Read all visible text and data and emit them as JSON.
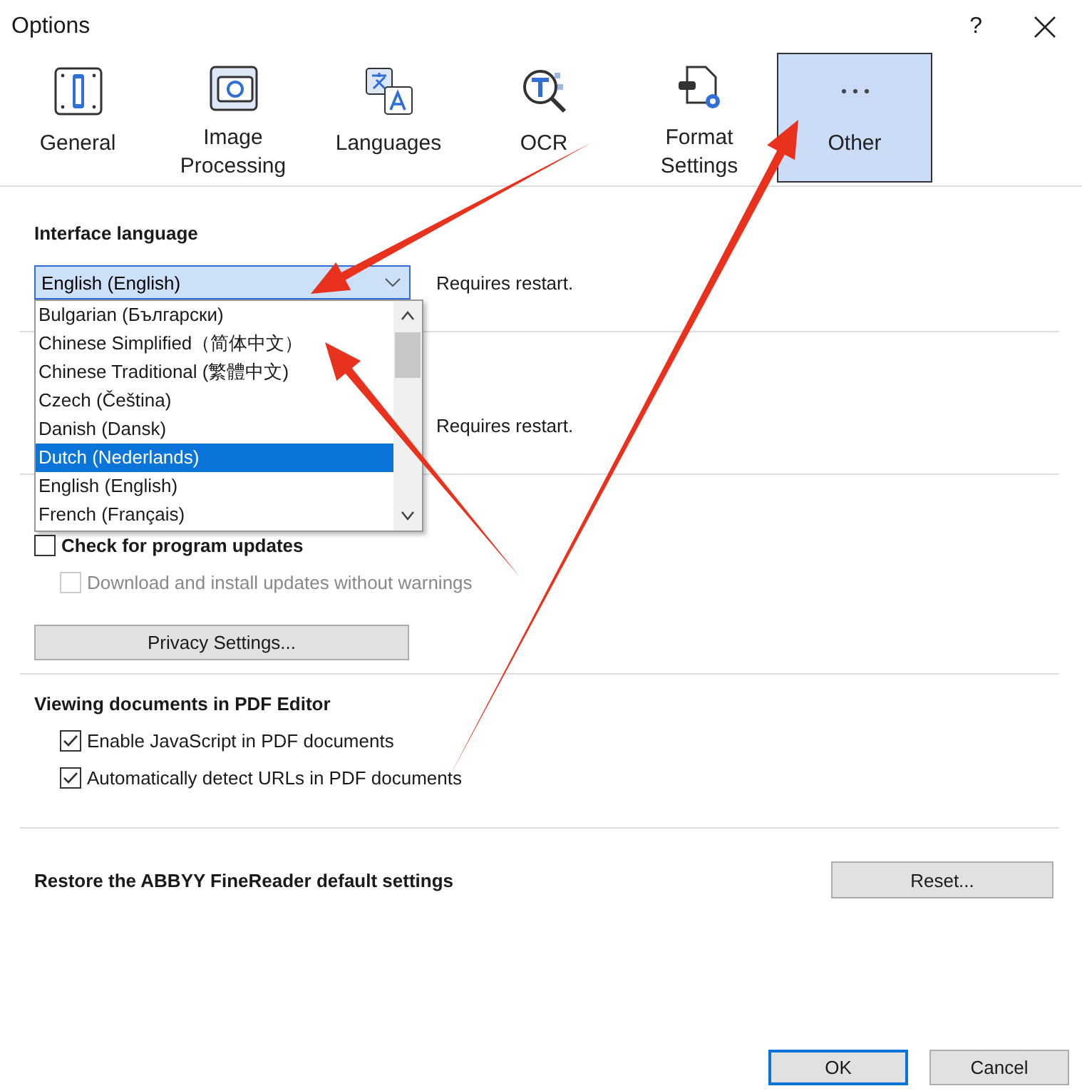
{
  "window": {
    "title": "Options",
    "help": "?"
  },
  "tabs": [
    {
      "label": "General",
      "kind": "general",
      "selected": false
    },
    {
      "label": "Image Processing",
      "kind": "image",
      "selected": false
    },
    {
      "label": "Languages",
      "kind": "languages",
      "selected": false
    },
    {
      "label": "OCR",
      "kind": "ocr",
      "selected": false
    },
    {
      "label": "Format Settings",
      "kind": "format",
      "selected": false
    },
    {
      "label": "Other",
      "kind": "other",
      "selected": true
    }
  ],
  "interface_language": {
    "label": "Interface language",
    "combo": {
      "value": "English (English)",
      "expanded": true
    },
    "note": "Requires restart.",
    "options": [
      {
        "label": "Bulgarian (Български)",
        "selected": false
      },
      {
        "label": "Chinese Simplified（简体中文）",
        "selected": false
      },
      {
        "label": "Chinese Traditional (繁體中文)",
        "selected": false
      },
      {
        "label": "Czech (Čeština)",
        "selected": false
      },
      {
        "label": "Danish (Dansk)",
        "selected": false
      },
      {
        "label": "Dutch (Nederlands)",
        "selected": true
      },
      {
        "label": "English (English)",
        "selected": false
      },
      {
        "label": "French (Français)",
        "selected": false
      }
    ]
  },
  "second_section": {
    "note": "Requires restart."
  },
  "updates": {
    "check": {
      "label": "Check for program updates",
      "checked": false,
      "disabled": false
    },
    "install": {
      "label": "Download and install updates without warnings",
      "checked": false,
      "disabled": true
    },
    "privacy_button": "Privacy Settings..."
  },
  "pdf_viewing": {
    "title": "Viewing documents in PDF Editor",
    "options": [
      {
        "label": "Enable JavaScript in PDF documents",
        "checked": true,
        "disabled": false
      },
      {
        "label": "Automatically detect URLs in PDF documents",
        "checked": true,
        "disabled": false
      }
    ]
  },
  "restore": {
    "text": "Restore the ABBYY FineReader default settings",
    "button": "Reset..."
  },
  "buttons": [
    {
      "label": "OK",
      "default": true
    },
    {
      "label": "Cancel",
      "default": false
    }
  ]
}
